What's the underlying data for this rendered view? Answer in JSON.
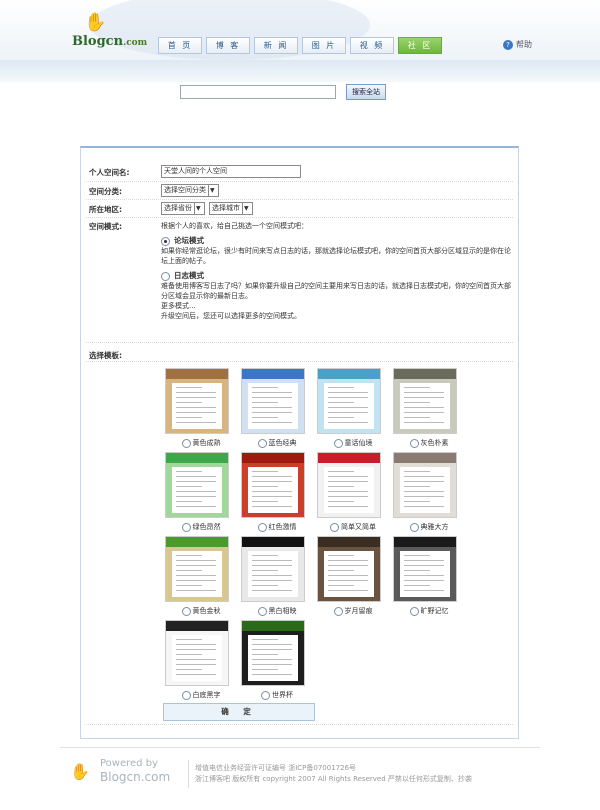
{
  "header": {
    "logo_text": "Blogcn",
    "logo_suffix": ".com",
    "nav": [
      "首 页",
      "博 客",
      "新 闻",
      "图 片",
      "视 频",
      "社 区"
    ],
    "active_tab": 5,
    "help_label": "帮助"
  },
  "search": {
    "placeholder": "",
    "button_label": "搜索全站"
  },
  "form": {
    "space_name_label": "个人空间名:",
    "space_name_value": "天堂人间的个人空间",
    "category_label": "空间分类:",
    "category_value": "选择空间分类",
    "region_label": "所在地区:",
    "province_value": "选择省份",
    "city_value": "选择城市",
    "mode_label": "空间模式:",
    "mode_intro": "根据个人的喜欢，给自己挑选一个空间模式吧：",
    "mode_forum_title": "论坛模式",
    "mode_forum_desc": "如果你经常逛论坛，很少有时间来写点日志的话，那就选择论坛模式吧，你的空间首页大部分区域显示的是你在论坛上面的帖子。",
    "mode_journal_title": "日志模式",
    "mode_journal_desc": "难备使用博客写日志了吗？如果你要升级自己的空间主要用来写日志的话，就选择日志模式吧，你的空间首页大部分区域会显示你的最新日志。",
    "mode_more_title": "更多模式...",
    "mode_more_desc": "升级空间后，您还可以选择更多的空间模式。",
    "selected_mode": "forum",
    "template_label": "选择模板:",
    "templates": [
      {
        "name": "黄色成熟",
        "bar": "#a07040",
        "bg": "#d8b480"
      },
      {
        "name": "蓝色经典",
        "bar": "#3a78c3",
        "bg": "#cfe0f3"
      },
      {
        "name": "童话仙境",
        "bar": "#4aa0c8",
        "bg": "#bfe3f0"
      },
      {
        "name": "灰色朴素",
        "bar": "#6b6b5c",
        "bg": "#c9c9bc"
      },
      {
        "name": "绿色昂然",
        "bar": "#3ca84a",
        "bg": "#9fd89a"
      },
      {
        "name": "红色激情",
        "bar": "#9c1a0e",
        "bg": "#c8402a"
      },
      {
        "name": "简单又简单",
        "bar": "#c81e2a",
        "bg": "#f1f1f1"
      },
      {
        "name": "典雅大方",
        "bar": "#8a7a70",
        "bg": "#e2dcd6"
      },
      {
        "name": "黄色金秋",
        "bar": "#4a9a2e",
        "bg": "#d8c890"
      },
      {
        "name": "黑白相映",
        "bar": "#111111",
        "bg": "#e8e8e8"
      },
      {
        "name": "岁月留痕",
        "bar": "#3a2e22",
        "bg": "#6a5440"
      },
      {
        "name": "旷野记忆",
        "bar": "#1a1a1a",
        "bg": "#5a5a5a"
      },
      {
        "name": "白底黑字",
        "bar": "#222222",
        "bg": "#f6f6f6"
      },
      {
        "name": "世界杯",
        "bar": "#2a6a1a",
        "bg": "#1e1e1e"
      }
    ],
    "confirm_label": "确 定"
  },
  "footer": {
    "powered_line1": "Powered by",
    "powered_line2": "Blogcn.com",
    "legal_line1": "增值电信业务经营许可证编号 浙ICP备07001726号",
    "legal_line2": "浙江博客吧 版权所有 copyright 2007 All Rights Reserved 严禁以任何形式复制、抄袭"
  }
}
